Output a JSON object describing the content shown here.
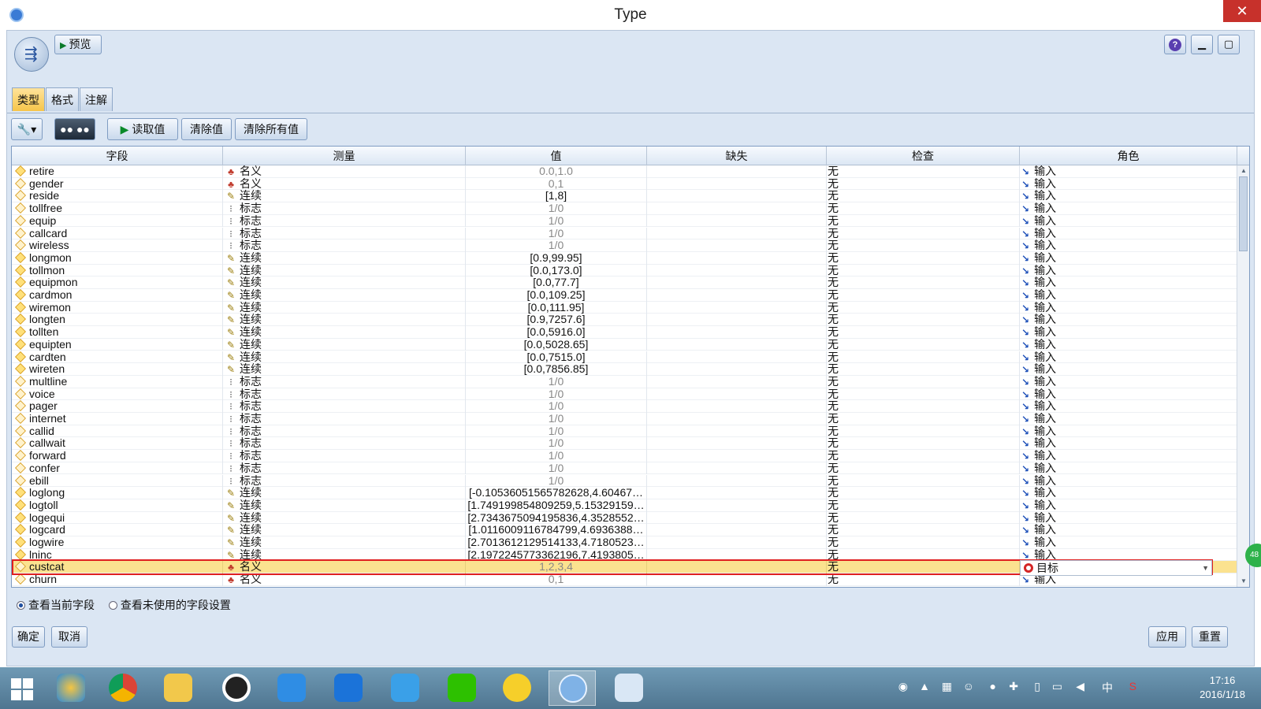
{
  "window": {
    "title": "Type",
    "close_label": "✕"
  },
  "toolbar_top": {
    "preview_label": "预览",
    "help_label": "?"
  },
  "tabs": [
    {
      "label": "类型",
      "active": true
    },
    {
      "label": "格式",
      "active": false
    },
    {
      "label": "注解",
      "active": false
    }
  ],
  "toolbar": {
    "view_label": "●● ●●",
    "read_values_label": "读取值",
    "clear_values_label": "清除值",
    "clear_all_values_label": "清除所有值"
  },
  "columns": [
    "字段",
    "测量",
    "值",
    "缺失",
    "检查",
    "角色"
  ],
  "rows": [
    {
      "field": "retire",
      "icon": "num",
      "measure": "名义",
      "mtype": "nominal",
      "value": "0.0,1.0",
      "gray": true,
      "check": "无",
      "role": "输入"
    },
    {
      "field": "gender",
      "icon": "str",
      "measure": "名义",
      "mtype": "nominal",
      "value": "0,1",
      "gray": true,
      "check": "无",
      "role": "输入"
    },
    {
      "field": "reside",
      "icon": "str",
      "measure": "连续",
      "mtype": "continuous",
      "value": "[1,8]",
      "gray": false,
      "check": "无",
      "role": "输入"
    },
    {
      "field": "tollfree",
      "icon": "str",
      "measure": "标志",
      "mtype": "flag",
      "value": "1/0",
      "gray": true,
      "check": "无",
      "role": "输入"
    },
    {
      "field": "equip",
      "icon": "str",
      "measure": "标志",
      "mtype": "flag",
      "value": "1/0",
      "gray": true,
      "check": "无",
      "role": "输入"
    },
    {
      "field": "callcard",
      "icon": "str",
      "measure": "标志",
      "mtype": "flag",
      "value": "1/0",
      "gray": true,
      "check": "无",
      "role": "输入"
    },
    {
      "field": "wireless",
      "icon": "str",
      "measure": "标志",
      "mtype": "flag",
      "value": "1/0",
      "gray": true,
      "check": "无",
      "role": "输入"
    },
    {
      "field": "longmon",
      "icon": "num",
      "measure": "连续",
      "mtype": "continuous",
      "value": "[0.9,99.95]",
      "gray": false,
      "check": "无",
      "role": "输入"
    },
    {
      "field": "tollmon",
      "icon": "num",
      "measure": "连续",
      "mtype": "continuous",
      "value": "[0.0,173.0]",
      "gray": false,
      "check": "无",
      "role": "输入"
    },
    {
      "field": "equipmon",
      "icon": "num",
      "measure": "连续",
      "mtype": "continuous",
      "value": "[0.0,77.7]",
      "gray": false,
      "check": "无",
      "role": "输入"
    },
    {
      "field": "cardmon",
      "icon": "num",
      "measure": "连续",
      "mtype": "continuous",
      "value": "[0.0,109.25]",
      "gray": false,
      "check": "无",
      "role": "输入"
    },
    {
      "field": "wiremon",
      "icon": "num",
      "measure": "连续",
      "mtype": "continuous",
      "value": "[0.0,111.95]",
      "gray": false,
      "check": "无",
      "role": "输入"
    },
    {
      "field": "longten",
      "icon": "num",
      "measure": "连续",
      "mtype": "continuous",
      "value": "[0.9,7257.6]",
      "gray": false,
      "check": "无",
      "role": "输入"
    },
    {
      "field": "tollten",
      "icon": "num",
      "measure": "连续",
      "mtype": "continuous",
      "value": "[0.0,5916.0]",
      "gray": false,
      "check": "无",
      "role": "输入"
    },
    {
      "field": "equipten",
      "icon": "num",
      "measure": "连续",
      "mtype": "continuous",
      "value": "[0.0,5028.65]",
      "gray": false,
      "check": "无",
      "role": "输入"
    },
    {
      "field": "cardten",
      "icon": "num",
      "measure": "连续",
      "mtype": "continuous",
      "value": "[0.0,7515.0]",
      "gray": false,
      "check": "无",
      "role": "输入"
    },
    {
      "field": "wireten",
      "icon": "num",
      "measure": "连续",
      "mtype": "continuous",
      "value": "[0.0,7856.85]",
      "gray": false,
      "check": "无",
      "role": "输入"
    },
    {
      "field": "multline",
      "icon": "str",
      "measure": "标志",
      "mtype": "flag",
      "value": "1/0",
      "gray": true,
      "check": "无",
      "role": "输入"
    },
    {
      "field": "voice",
      "icon": "str",
      "measure": "标志",
      "mtype": "flag",
      "value": "1/0",
      "gray": true,
      "check": "无",
      "role": "输入"
    },
    {
      "field": "pager",
      "icon": "str",
      "measure": "标志",
      "mtype": "flag",
      "value": "1/0",
      "gray": true,
      "check": "无",
      "role": "输入"
    },
    {
      "field": "internet",
      "icon": "str",
      "measure": "标志",
      "mtype": "flag",
      "value": "1/0",
      "gray": true,
      "check": "无",
      "role": "输入"
    },
    {
      "field": "callid",
      "icon": "str",
      "measure": "标志",
      "mtype": "flag",
      "value": "1/0",
      "gray": true,
      "check": "无",
      "role": "输入"
    },
    {
      "field": "callwait",
      "icon": "str",
      "measure": "标志",
      "mtype": "flag",
      "value": "1/0",
      "gray": true,
      "check": "无",
      "role": "输入"
    },
    {
      "field": "forward",
      "icon": "str",
      "measure": "标志",
      "mtype": "flag",
      "value": "1/0",
      "gray": true,
      "check": "无",
      "role": "输入"
    },
    {
      "field": "confer",
      "icon": "str",
      "measure": "标志",
      "mtype": "flag",
      "value": "1/0",
      "gray": true,
      "check": "无",
      "role": "输入"
    },
    {
      "field": "ebill",
      "icon": "str",
      "measure": "标志",
      "mtype": "flag",
      "value": "1/0",
      "gray": true,
      "check": "无",
      "role": "输入"
    },
    {
      "field": "loglong",
      "icon": "num",
      "measure": "连续",
      "mtype": "continuous",
      "value": "[-0.10536051565782628,4.60467…",
      "gray": false,
      "check": "无",
      "role": "输入"
    },
    {
      "field": "logtoll",
      "icon": "num",
      "measure": "连续",
      "mtype": "continuous",
      "value": "[1.749199854809259,5.15329159…",
      "gray": false,
      "check": "无",
      "role": "输入"
    },
    {
      "field": "logequi",
      "icon": "num",
      "measure": "连续",
      "mtype": "continuous",
      "value": "[2.7343675094195836,4.3528552…",
      "gray": false,
      "check": "无",
      "role": "输入"
    },
    {
      "field": "logcard",
      "icon": "num",
      "measure": "连续",
      "mtype": "continuous",
      "value": "[1.0116009116784799,4.6936388…",
      "gray": false,
      "check": "无",
      "role": "输入"
    },
    {
      "field": "logwire",
      "icon": "num",
      "measure": "连续",
      "mtype": "continuous",
      "value": "[2.7013612129514133,4.7180523…",
      "gray": false,
      "check": "无",
      "role": "输入"
    },
    {
      "field": "lninc",
      "icon": "num",
      "measure": "连续",
      "mtype": "continuous",
      "value": "[2.1972245773362196,7.4193805…",
      "gray": false,
      "check": "无",
      "role": "输入"
    },
    {
      "field": "custcat",
      "icon": "str",
      "measure": "名义",
      "mtype": "nominal",
      "value": "1,2,3,4",
      "gray": true,
      "check": "无",
      "role": "目标",
      "selected": true
    },
    {
      "field": "churn",
      "icon": "str",
      "measure": "名义",
      "mtype": "nominal",
      "value": "0,1",
      "gray": true,
      "check": "无",
      "role": "输入"
    }
  ],
  "radios": [
    {
      "label": "查看当前字段",
      "checked": true
    },
    {
      "label": "查看未使用的字段设置",
      "checked": false
    }
  ],
  "buttons": {
    "ok": "确定",
    "cancel": "取消",
    "apply": "应用",
    "reset": "重置"
  },
  "badge": "48",
  "taskbar": {
    "apps": [
      "start-icon",
      "360-icon",
      "chrome-icon",
      "file-explorer-icon",
      "qq-icon",
      "baidu-cloud-icon",
      "baidu-netdisk-icon",
      "ime-icon",
      "wechat-icon",
      "emoji-icon",
      "spss-modeler-icon",
      "paint-icon"
    ],
    "time": "17:16",
    "date": "2016/1/18",
    "ime_label": "中"
  },
  "colors": {
    "selected_row": "#fbe28f",
    "selection_outline": "#e02020",
    "tab_active": "#f6c54a",
    "role_input": "#1d4fb8",
    "role_target": "#d42626"
  }
}
